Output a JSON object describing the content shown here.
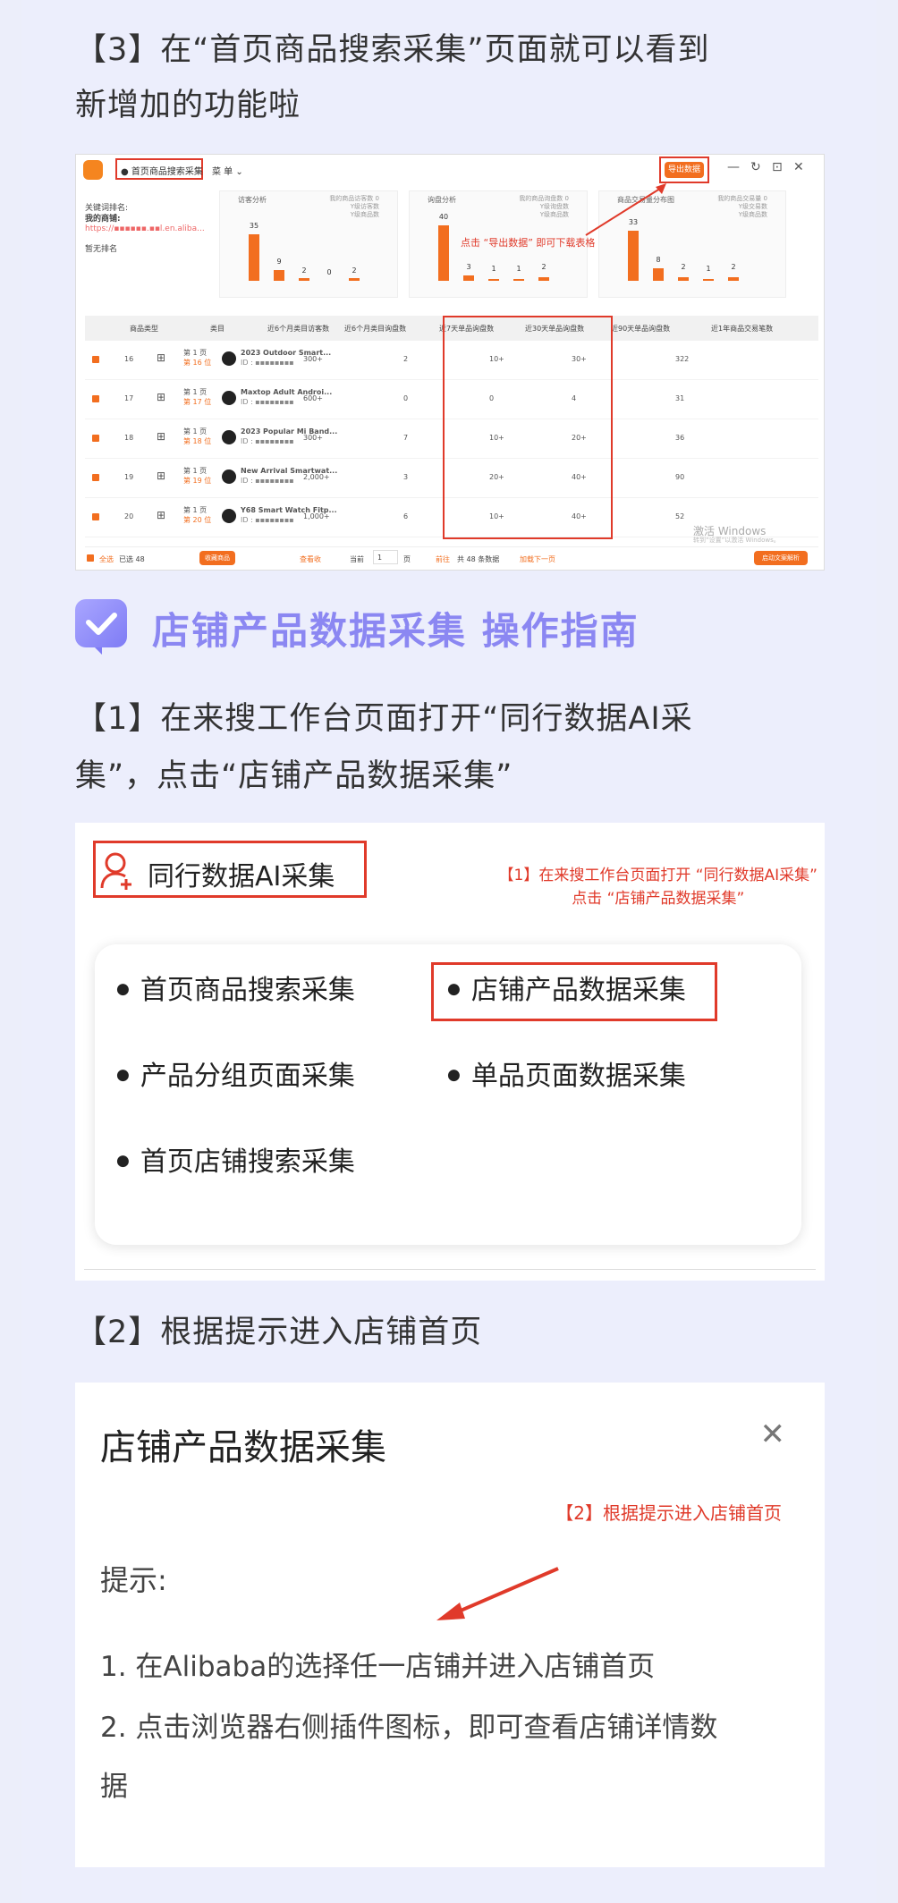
{
  "step3": {
    "line1": "【3】在“首页商品搜索采集”页面就可以看到",
    "line2": "新增加的功能啦"
  },
  "app": {
    "tab_title": "● 首页商品搜索采集",
    "menu_label": "菜 单 ⌄",
    "export_button": "导出数据",
    "window_controls": [
      "—",
      "↻",
      "⊡",
      "✕"
    ],
    "sidebar": {
      "keyword_label": "关键词排名:",
      "store_label": "我的商铺:",
      "store_link": "https://▪▪▪▪▪▪.▪▪l.en.aliba...",
      "no_rank": "暂无排名"
    },
    "annotation": "点击 “导出数据” 即可下载表格",
    "cards": [
      {
        "title": "访客分析",
        "legend": [
          "我的商品访客数 0",
          "Y级访客数",
          "Y级商品数"
        ]
      },
      {
        "title": "询盘分析",
        "legend": [
          "我的商品询盘数 0",
          "Y级询盘数",
          "Y级商品数"
        ]
      },
      {
        "title": "商品交易量分布图",
        "legend": [
          "我的商品交易量 0",
          "Y级交易数",
          "Y级商品数"
        ]
      }
    ],
    "table_headers": [
      "商品类型",
      "类目",
      "近6个月类目访客数",
      "近6个月类目询盘数",
      "近7天单品询盘数",
      "近30天单品询盘数",
      "近90天单品询盘数",
      "近1年商品交易笔数"
    ],
    "rows": [
      {
        "no": "16",
        "rank_page": "第 1 页",
        "rank_pos": "第 16 位",
        "name": "2023 Outdoor Smart...",
        "id": "ID : ▪▪▪▪▪▪▪▪",
        "visits": "300+",
        "d7": "2",
        "d30": "10+",
        "d90": "30+",
        "year": "322"
      },
      {
        "no": "17",
        "rank_page": "第 1 页",
        "rank_pos": "第 17 位",
        "name": "Maxtop Adult Androi...",
        "id": "ID : ▪▪▪▪▪▪▪▪",
        "visits": "600+",
        "d7": "0",
        "d30": "0",
        "d90": "4",
        "year": "31"
      },
      {
        "no": "18",
        "rank_page": "第 1 页",
        "rank_pos": "第 18 位",
        "name": "2023 Popular Mi Band...",
        "id": "ID : ▪▪▪▪▪▪▪▪",
        "visits": "300+",
        "d7": "7",
        "d30": "10+",
        "d90": "20+",
        "year": "36"
      },
      {
        "no": "19",
        "rank_page": "第 1 页",
        "rank_pos": "第 19 位",
        "name": "New Arrival Smartwat...",
        "id": "ID : ▪▪▪▪▪▪▪▪",
        "visits": "2,000+",
        "d7": "3",
        "d30": "20+",
        "d90": "40+",
        "year": "90"
      },
      {
        "no": "20",
        "rank_page": "第 1 页",
        "rank_pos": "第 20 位",
        "name": "Y68 Smart Watch Fitp...",
        "id": "ID : ▪▪▪▪▪▪▪▪",
        "visits": "1,000+",
        "d7": "6",
        "d30": "10+",
        "d90": "40+",
        "year": "52"
      }
    ],
    "footer": {
      "select_all": "全选",
      "selected": "已选 48",
      "collect": "收藏商品",
      "view": "查看收",
      "current": "当前",
      "page": "1",
      "page_unit": "页",
      "goto": "前往",
      "total": "共 48 条数据",
      "next": "加载下一页",
      "export_doc": "启动文案解析"
    },
    "watermark": "激活 Windows",
    "watermark_sub": "转到“设置”以激活 Windows。"
  },
  "headline": "店铺产品数据采集 操作指南",
  "step1": {
    "line1": "【1】在来搜工作台页面打开“同行数据AI采",
    "line2": "集”，点击“店铺产品数据采集”"
  },
  "panel": {
    "title": "同行数据AI采集",
    "annotation_line1": "【1】在来搜工作台页面打开 “同行数据AI采集”",
    "annotation_line2": "点击 “店铺产品数据采集”",
    "options": [
      "首页商品搜索采集",
      "店铺产品数据采集",
      "产品分组页面采集",
      "单品页面数据采集",
      "首页店铺搜索采集"
    ]
  },
  "step2": {
    "text": "【2】根据提示进入店铺首页"
  },
  "dialog": {
    "title": "店铺产品数据采集",
    "close": "✕",
    "annotation": "【2】根据提示进入店铺首页",
    "hint_label": "提示:",
    "line1": "1. 在Alibaba的选择任一店铺并进入店铺首页",
    "line2": "2. 点击浏览器右侧插件图标，即可查看店铺详情数",
    "line3": "据"
  },
  "colors": {
    "accent": "#f26e1f",
    "annotation_red": "#e03a2a",
    "headline_purple": "#8b87f2",
    "background": "#eceefc"
  }
}
